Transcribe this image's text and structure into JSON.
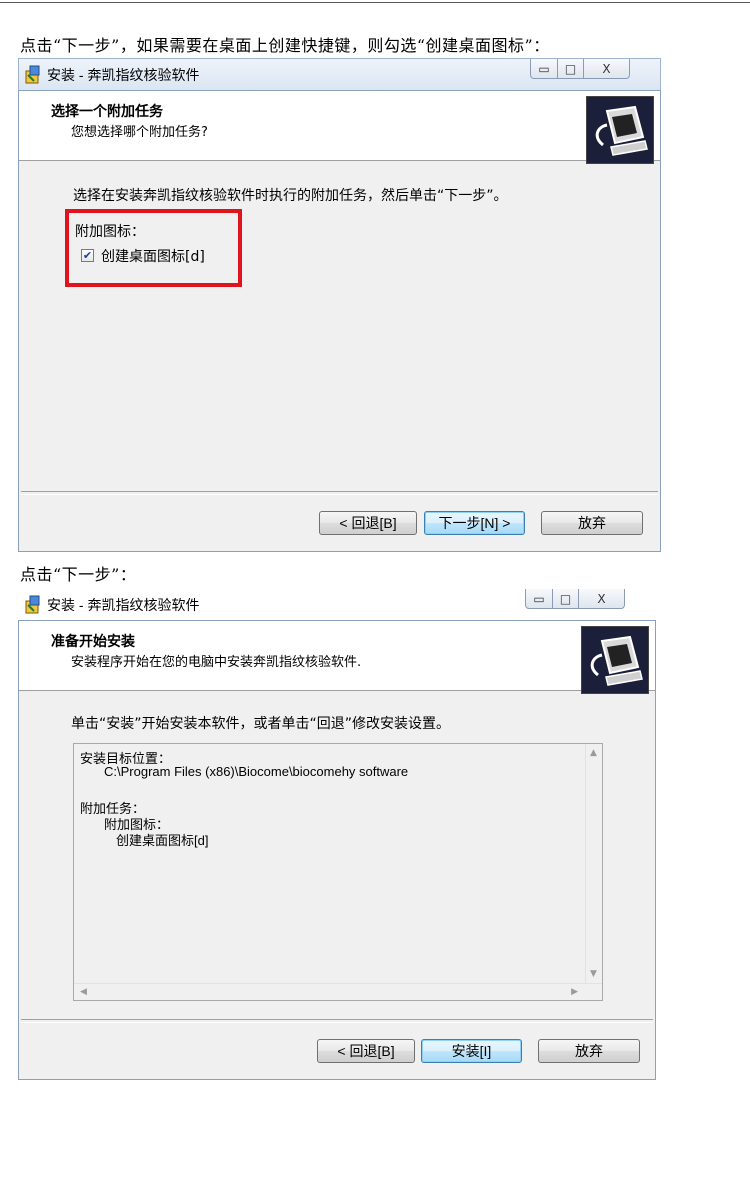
{
  "caption1": "点击“下一步”，如果需要在桌面上创建快捷键，则勾选“创建桌面图标”：",
  "caption2": "点击“下一步”：",
  "window_title": "安装 - 奔凯指纹核验软件",
  "window_controls": {
    "minimize": "▭",
    "maximize": "□",
    "close": "X"
  },
  "dialog1": {
    "header_title": "选择一个附加任务",
    "header_subtitle": "您想选择哪个附加任务?",
    "instruction": "选择在安装奔凯指纹核验软件时执行的附加任务，然后单击“下一步”。",
    "group_label": "附加图标：",
    "checkbox_label": "创建桌面图标[d]",
    "checkbox_checked": true,
    "buttons": {
      "back": "< 回退[B]",
      "next": "下一步[N] >",
      "cancel": "放弃"
    },
    "highlight_color": "#e0141c"
  },
  "dialog2": {
    "header_title": "准备开始安装",
    "header_subtitle": "安装程序开始在您的电脑中安装奔凯指纹核验软件.",
    "instruction": "单击“安装”开始安装本软件，或者单击“回退”修改安装设置。",
    "memo_lines": [
      "安装目标位置：",
      "C:\\Program Files (x86)\\Biocome\\biocomehy software",
      "",
      "附加任务：",
      "附加图标：",
      "创建桌面图标[d]"
    ],
    "buttons": {
      "back": "< 回退[B]",
      "install": "安装[I]",
      "cancel": "放弃"
    }
  },
  "colors": {
    "header_icon_bg": "#1b1f3a",
    "default_button_border": "#3c7fb1"
  }
}
